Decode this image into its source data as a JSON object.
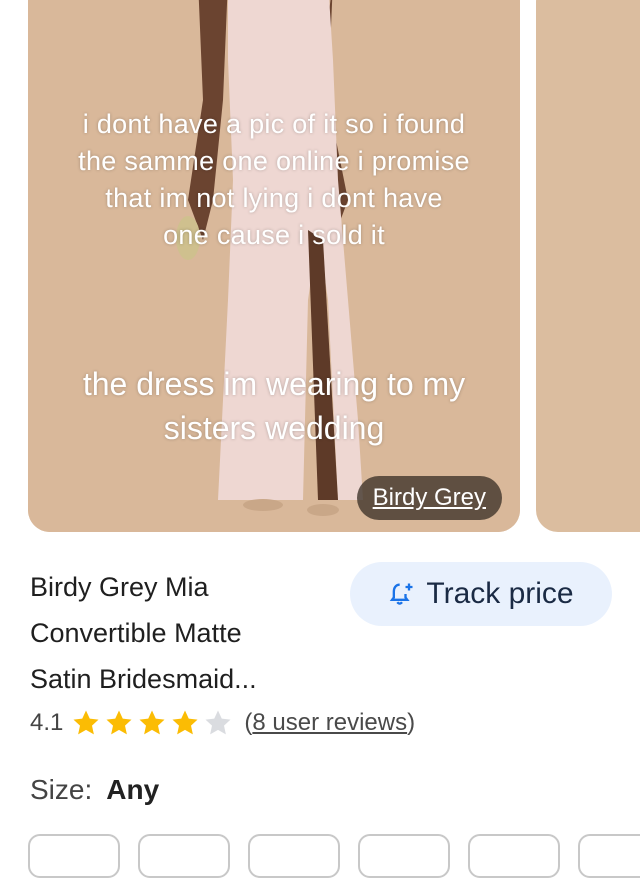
{
  "image": {
    "caption_top": [
      "i dont have a pic of it so i found",
      "the samme one online i promise",
      "that im not lying i dont have",
      "one cause i sold it"
    ],
    "caption_bottom": [
      "the dress im wearing to my",
      "sisters wedding"
    ],
    "source": "Birdy Grey"
  },
  "product": {
    "title_lines": [
      "Birdy Grey Mia",
      "Convertible Matte",
      "Satin Bridesmaid..."
    ],
    "track_label": "Track price",
    "rating": "4.1",
    "stars": 4,
    "reviews": "8 user reviews",
    "size_label": "Size:",
    "size_value": "Any"
  },
  "colors": {
    "star": "#fbbc04",
    "star_empty": "#dadce0",
    "track_bg": "#e9f1fd",
    "track_icon": "#1a73e8"
  }
}
